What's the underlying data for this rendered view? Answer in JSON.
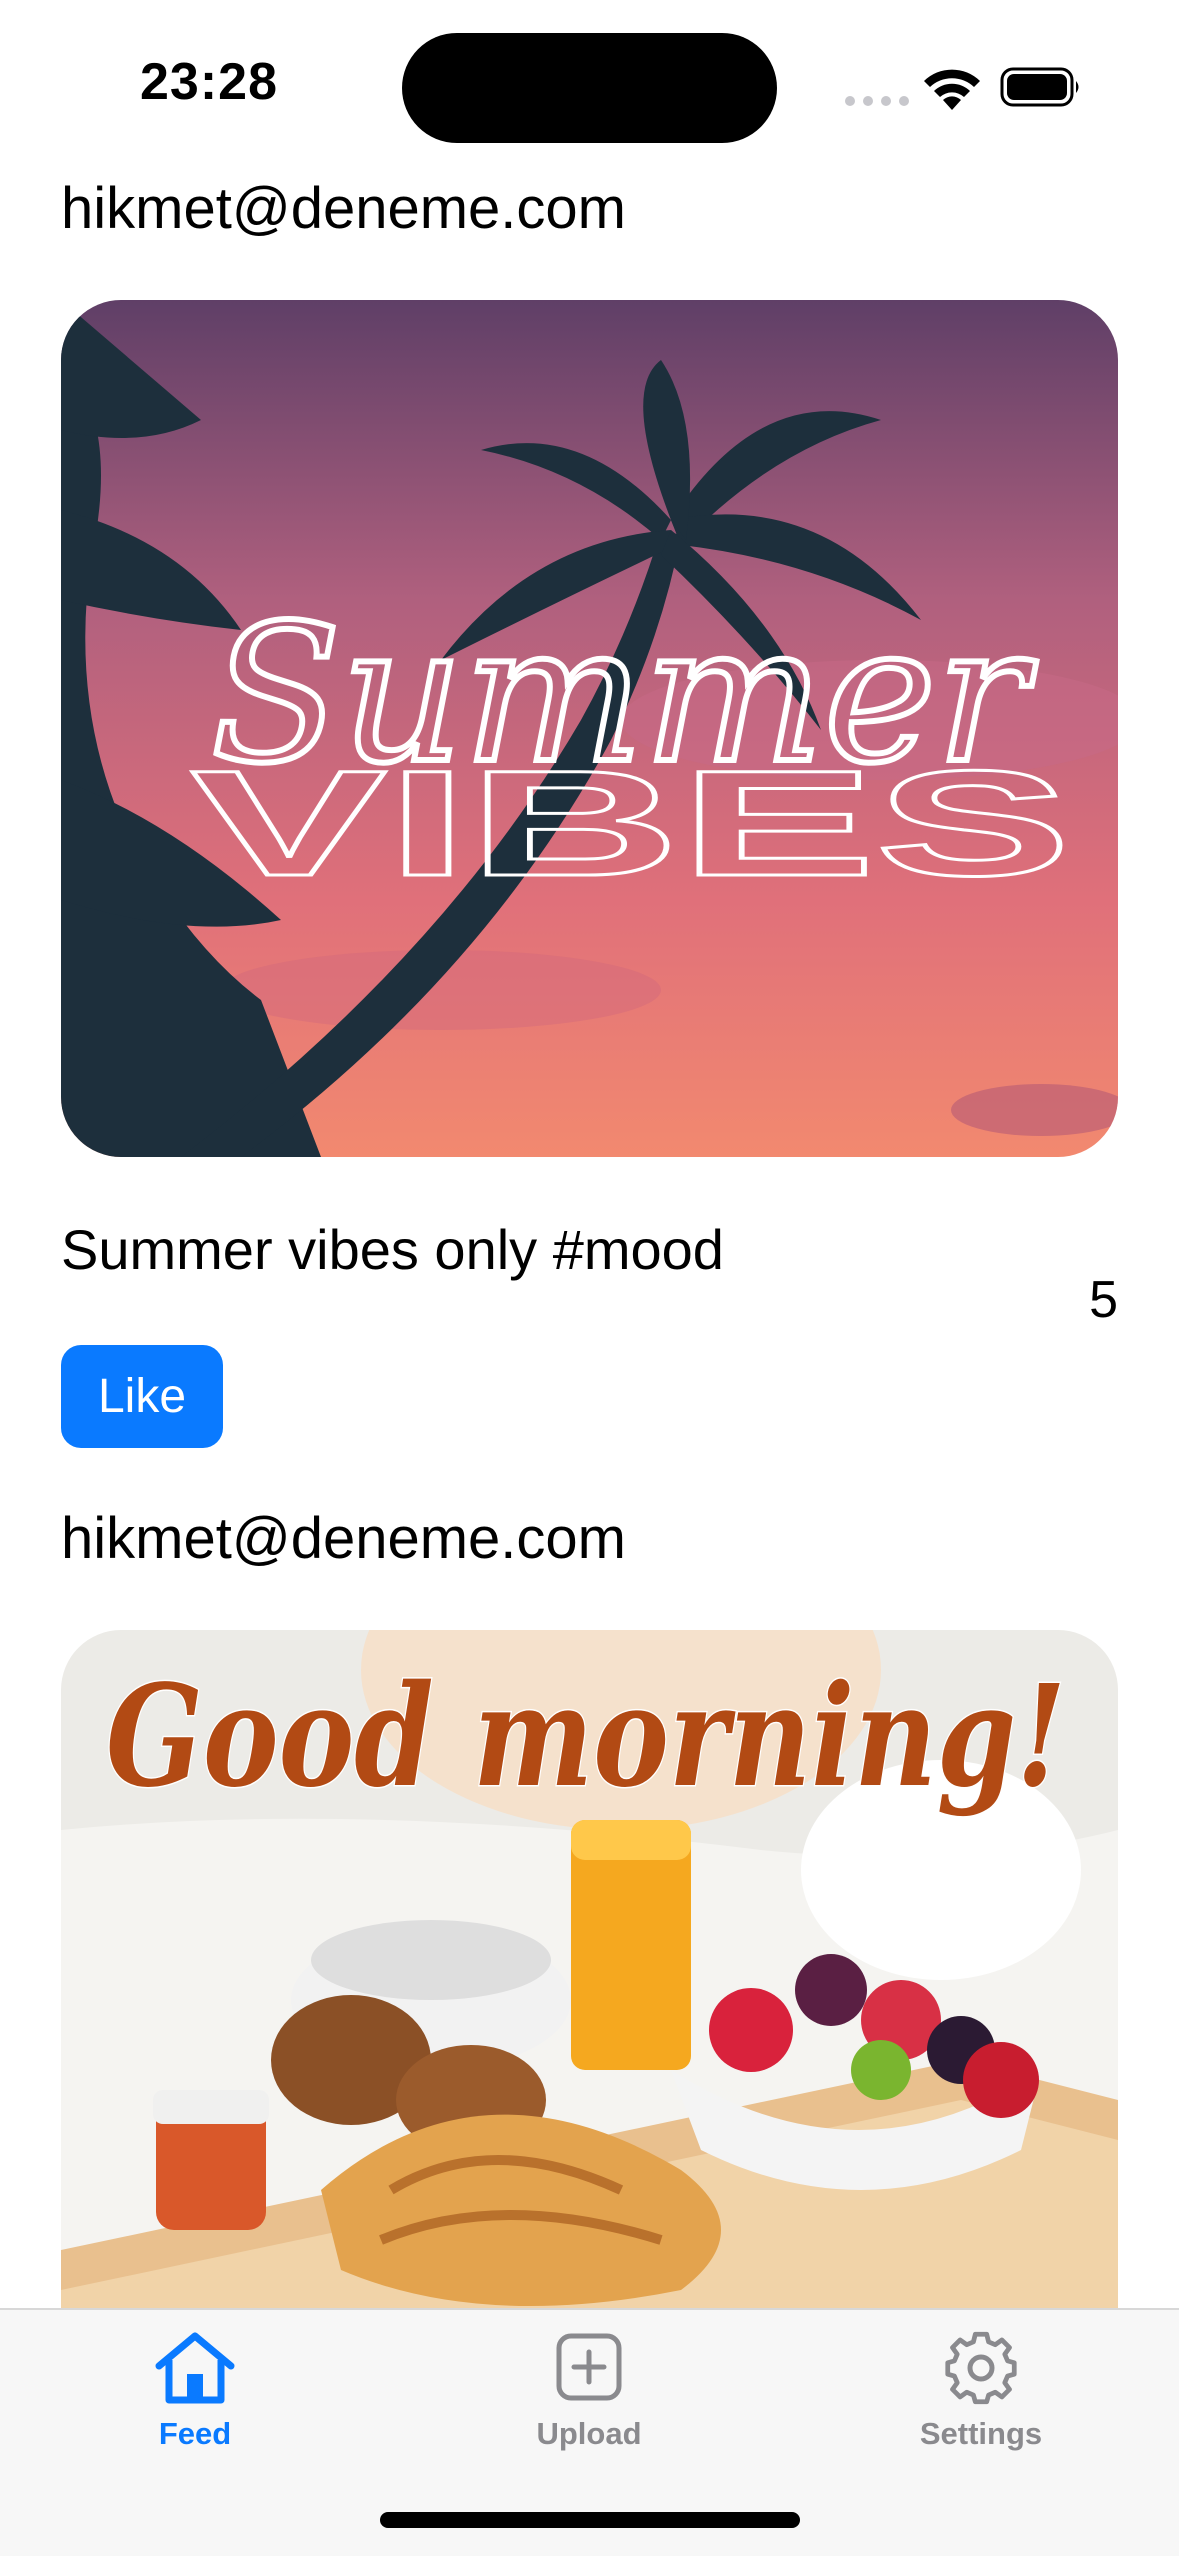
{
  "status_bar": {
    "time": "23:28"
  },
  "feed": {
    "posts": [
      {
        "author": "hikmet@deneme.com",
        "image_text_script": "Summer",
        "image_text_block": "VIBES",
        "caption": "Summer vibes only #mood",
        "like_count": "5",
        "like_label": "Like"
      },
      {
        "author": "hikmet@deneme.com",
        "image_text_script": "Good morning!"
      }
    ]
  },
  "tab_bar": {
    "tabs": [
      {
        "label": "Feed",
        "icon": "house-icon",
        "active": true
      },
      {
        "label": "Upload",
        "icon": "plus-square-icon",
        "active": false
      },
      {
        "label": "Settings",
        "icon": "gear-icon",
        "active": false
      }
    ]
  },
  "colors": {
    "accent": "#0a7aff",
    "inactive_tab": "#8a8a8e",
    "tab_bar_bg": "#f7f7f7"
  }
}
